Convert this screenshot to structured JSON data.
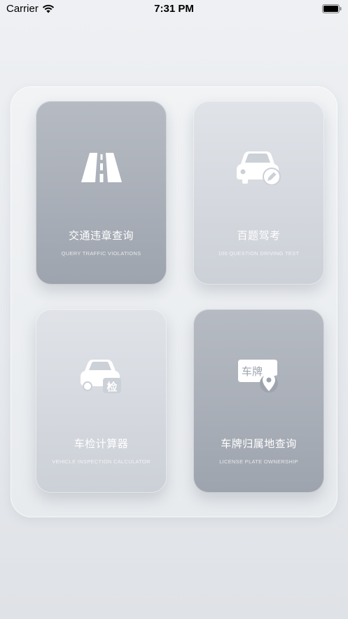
{
  "status_bar": {
    "carrier": "Carrier",
    "time": "7:31 PM"
  },
  "cards": [
    {
      "title": "交通违章查询",
      "subtitle": "QUERY TRAFFIC VIOLATIONS",
      "icon": "road-icon"
    },
    {
      "title": "百题驾考",
      "subtitle": "100 QUESTION DRIVING TEST",
      "icon": "car-pencil-icon"
    },
    {
      "title": "车检计算器",
      "subtitle": "VEHICLE INSPECTION CALCULATOR",
      "icon": "car-inspection-icon",
      "icon_text": "检"
    },
    {
      "title": "车牌归属地查询",
      "subtitle": "LICENSE PLATE OWNERSHIP",
      "icon": "license-plate-location-icon",
      "icon_text": "车牌"
    }
  ],
  "colors": {
    "card_dark": "#9ea4ae",
    "card_light": "#ccd0d7",
    "text": "#ffffff"
  }
}
